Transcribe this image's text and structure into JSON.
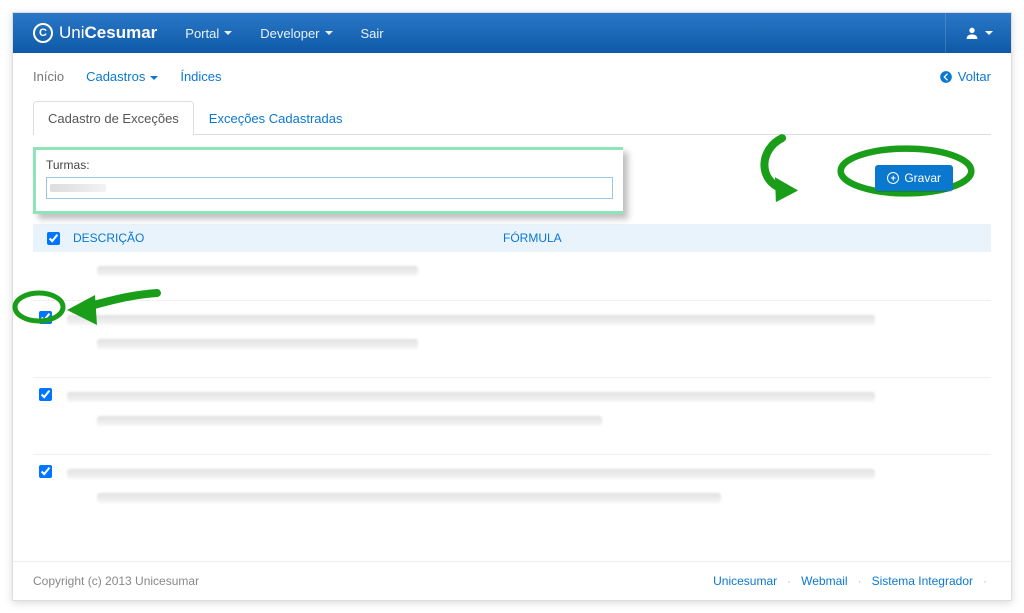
{
  "navbar": {
    "brand_prefix": "Uni",
    "brand_suffix": "Cesumar",
    "portal": "Portal",
    "developer": "Developer",
    "sair": "Sair"
  },
  "subnav": {
    "inicio": "Início",
    "cadastros": "Cadastros",
    "indices": "Índices",
    "voltar": "Voltar"
  },
  "tabs": {
    "cadastro": "Cadastro de Exceções",
    "excecoes": "Exceções Cadastradas"
  },
  "turmas": {
    "label": "Turmas:",
    "value": ""
  },
  "actions": {
    "gravar": "Gravar"
  },
  "table": {
    "col_descricao": "DESCRIÇÃO",
    "col_formula": "FÓRMULA",
    "rows": [
      {
        "checked": true,
        "desc": "",
        "formula": ""
      },
      {
        "checked": true,
        "desc": "",
        "formula": ""
      },
      {
        "checked": true,
        "desc": "",
        "formula": ""
      }
    ]
  },
  "footer": {
    "copyright": "Copyright (c) 2013 Unicesumar",
    "link_unicesumar": "Unicesumar",
    "link_webmail": "Webmail",
    "link_integrador": "Sistema Integrador"
  },
  "annotations": {
    "green": "#1a9e1a"
  }
}
